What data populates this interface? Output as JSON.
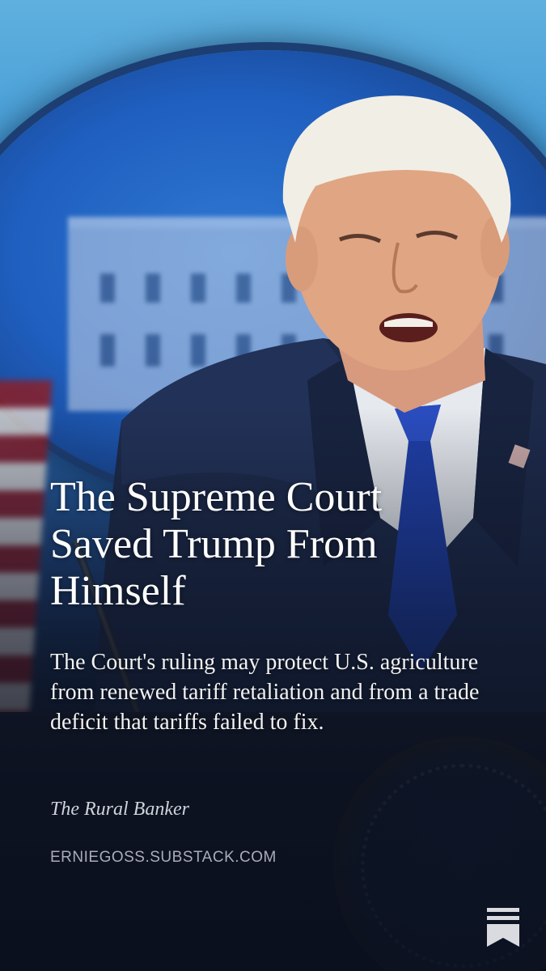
{
  "post": {
    "title": "The Supreme Court Saved Trump From Himself",
    "subtitle": "The Court's ruling may protect U.S. agriculture from renewed tariff retaliation and from a trade deficit that tariffs failed to fix.",
    "publication": "The Rural Banker",
    "domain": "ERNIEGOSS.SUBSTACK.COM"
  },
  "icons": {
    "logo": "substack-bookmark-icon"
  },
  "colors": {
    "background": "#0d1424",
    "headline_text": "#ffffff",
    "muted_text": "#a9adb6",
    "tie_blue": "#1f3fa8"
  }
}
